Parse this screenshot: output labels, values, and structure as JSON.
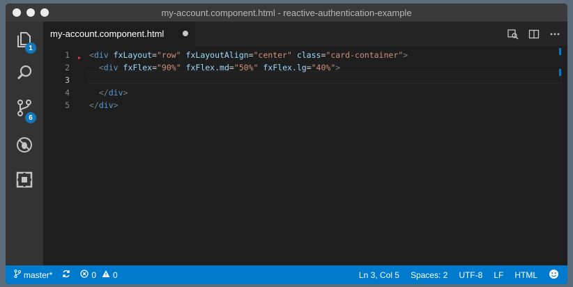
{
  "window": {
    "title": "my-account.component.html - reactive-authentication-example"
  },
  "activity_bar": {
    "items": [
      {
        "icon": "files-icon",
        "badge": "1"
      },
      {
        "icon": "search-icon",
        "badge": ""
      },
      {
        "icon": "source-control-icon",
        "badge": "6"
      },
      {
        "icon": "debug-icon",
        "badge": ""
      },
      {
        "icon": "extensions-icon",
        "badge": ""
      }
    ]
  },
  "tab": {
    "label": "my-account.component.html",
    "dirty": true
  },
  "editor": {
    "line_numbers": [
      "1",
      "2",
      "3",
      "4",
      "5"
    ],
    "active_line": "3"
  },
  "code": {
    "l1": {
      "open": "<",
      "tag": "div",
      "a1": "fxLayout",
      "v1": "\"row\"",
      "a2": "fxLayoutAlign",
      "v2": "\"center\"",
      "a3": "class",
      "v3": "\"card-container\"",
      "close": ">"
    },
    "l2": {
      "open": "<",
      "tag": "div",
      "a1": "fxFlex",
      "v1": "\"90%\"",
      "a2": "fxFlex.md",
      "v2": "\"50%\"",
      "a3": "fxFlex.lg",
      "v3": "\"40%\"",
      "close": ">"
    },
    "l4": {
      "open": "</",
      "tag": "div",
      "close": ">"
    },
    "l5": {
      "open": "</",
      "tag": "div",
      "close": ">"
    },
    "eq": "="
  },
  "status_bar": {
    "branch": "master*",
    "errors": "0",
    "warnings": "0",
    "position": "Ln 3, Col 5",
    "indent": "Spaces: 2",
    "encoding": "UTF-8",
    "eol": "LF",
    "language": "HTML"
  },
  "colors": {
    "status_bar": "#007acc",
    "badge": "#1177bb",
    "editor_bg": "#1e1e1e"
  }
}
